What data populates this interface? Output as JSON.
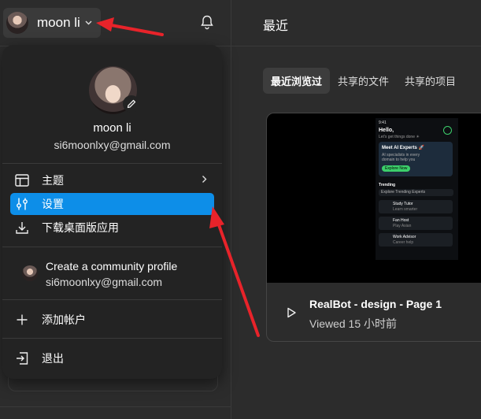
{
  "user": {
    "name": "moon li",
    "email": "si6moonlxy@gmail.com"
  },
  "main": {
    "title": "最近",
    "tabs": [
      {
        "label": "最近浏览过",
        "active": true
      },
      {
        "label": "共享的文件",
        "active": false
      },
      {
        "label": "共享的项目",
        "active": false
      }
    ],
    "file": {
      "name": "RealBot - design - Page 1",
      "time": "Viewed 15 小时前"
    }
  },
  "preview": {
    "time": "9:41",
    "greeting": "Hello,",
    "sub": "Let's get things done ☀",
    "card_title": "Meet AI Experts 🚀",
    "card_text": "AI specialists in every domain to help you",
    "card_button": "Explore Now",
    "section": "Trending",
    "filter": "Explore Trending Experts",
    "list": [
      {
        "name": "Study Tutor",
        "desc": "Learn smarter"
      },
      {
        "name": "Fan Host",
        "desc": "Play Asian"
      },
      {
        "name": "Work Advisor",
        "desc": "Career help"
      }
    ]
  },
  "menu": {
    "items": [
      {
        "label": "主题",
        "icon": "layout-icon",
        "selected": false,
        "has_submenu": true
      },
      {
        "label": "设置",
        "icon": "sliders-icon",
        "selected": true,
        "has_submenu": false
      },
      {
        "label": "下载桌面版应用",
        "icon": "download-icon",
        "selected": false,
        "has_submenu": false
      }
    ],
    "community": {
      "title": "Create a community profile",
      "email": "si6moonlxy@gmail.com"
    },
    "add_account": "添加帐户",
    "logout": "退出"
  },
  "colors": {
    "selected": "#0d8ee8",
    "annotation": "#e8232a"
  }
}
